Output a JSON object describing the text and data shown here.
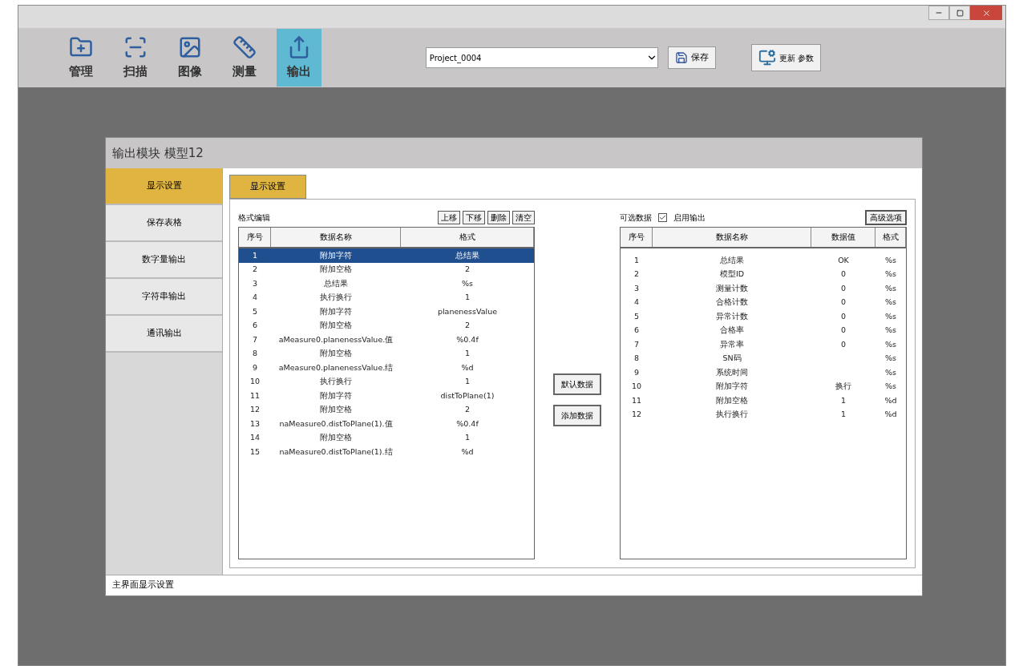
{
  "toolbar": {
    "tools": [
      {
        "label": "管理",
        "selected": false
      },
      {
        "label": "扫描",
        "selected": false
      },
      {
        "label": "图像",
        "selected": false
      },
      {
        "label": "测量",
        "selected": false
      },
      {
        "label": "输出",
        "selected": true
      }
    ],
    "project": {
      "value": "Project_0004"
    },
    "save_button": "保存",
    "update_button": "更新 参数"
  },
  "dialog": {
    "title": "输出模块 模型12",
    "sidebar": [
      {
        "label": "显示设置",
        "selected": true
      },
      {
        "label": "保存表格",
        "selected": false
      },
      {
        "label": "数字量输出",
        "selected": false
      },
      {
        "label": "字符串输出",
        "selected": false
      },
      {
        "label": "通讯输出",
        "selected": false
      }
    ],
    "tab": {
      "label": "显示设置",
      "selected": true
    },
    "format_edit": {
      "label": "格式编辑",
      "buttons": [
        "上移",
        "下移",
        "删除",
        "清空"
      ],
      "columns": [
        "序号",
        "数据名称",
        "格式"
      ],
      "rows": [
        {
          "cells": [
            "1",
            "附加字符",
            "总结果"
          ],
          "selected": true
        },
        {
          "cells": [
            "2",
            "附加空格",
            "2"
          ],
          "selected": false
        },
        {
          "cells": [
            "3",
            "总结果",
            "%s"
          ],
          "selected": false
        },
        {
          "cells": [
            "4",
            "执行换行",
            "1"
          ],
          "selected": false
        },
        {
          "cells": [
            "5",
            "附加字符",
            "planenessValue"
          ],
          "selected": false
        },
        {
          "cells": [
            "6",
            "附加空格",
            "2"
          ],
          "selected": false
        },
        {
          "cells": [
            "7",
            "aMeasure0.planenessValue.值",
            "%0.4f"
          ],
          "selected": false
        },
        {
          "cells": [
            "8",
            "附加空格",
            "1"
          ],
          "selected": false
        },
        {
          "cells": [
            "9",
            "aMeasure0.planenessValue.结",
            "%d"
          ],
          "selected": false
        },
        {
          "cells": [
            "10",
            "执行换行",
            "1"
          ],
          "selected": false
        },
        {
          "cells": [
            "11",
            "附加字符",
            "distToPlane(1)"
          ],
          "selected": false
        },
        {
          "cells": [
            "12",
            "附加空格",
            "2"
          ],
          "selected": false
        },
        {
          "cells": [
            "13",
            "naMeasure0.distToPlane(1).值",
            "%0.4f"
          ],
          "selected": false
        },
        {
          "cells": [
            "14",
            "附加空格",
            "1"
          ],
          "selected": false
        },
        {
          "cells": [
            "15",
            "naMeasure0.distToPlane(1).结",
            "%d"
          ],
          "selected": false
        }
      ]
    },
    "middle_buttons": [
      "默认数据",
      "添加数据"
    ],
    "available": {
      "label": "可选数据",
      "enable_output": {
        "label": "启用输出",
        "checked": true
      },
      "advanced_button": "高级选项",
      "columns": [
        "序号",
        "数据名称",
        "数据值",
        "格式"
      ],
      "rows": [
        [
          "1",
          "总结果",
          "OK",
          "%s"
        ],
        [
          "2",
          "模型ID",
          "0",
          "%s"
        ],
        [
          "3",
          "测量计数",
          "0",
          "%s"
        ],
        [
          "4",
          "合格计数",
          "0",
          "%s"
        ],
        [
          "5",
          "异常计数",
          "0",
          "%s"
        ],
        [
          "6",
          "合格率",
          "0",
          "%s"
        ],
        [
          "7",
          "异常率",
          "0",
          "%s"
        ],
        [
          "8",
          "SN码",
          "",
          "%s"
        ],
        [
          "9",
          "系统时间",
          "",
          "%s"
        ],
        [
          "10",
          "附加字符",
          "换行",
          "%s"
        ],
        [
          "11",
          "附加空格",
          "1",
          "%d"
        ],
        [
          "12",
          "执行换行",
          "1",
          "%d"
        ]
      ]
    },
    "status": "主界面显示设置"
  }
}
